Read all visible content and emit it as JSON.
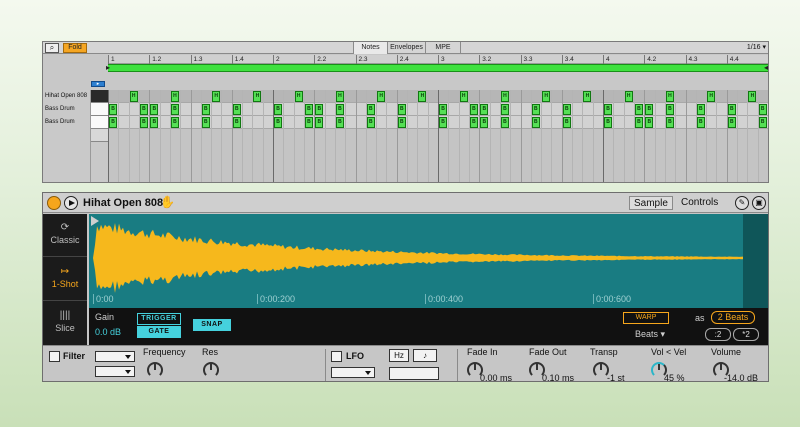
{
  "clip": {
    "fold_label": "Fold",
    "tabs": [
      "Notes",
      "Envelopes",
      "MPE"
    ],
    "grid": "1/16 ▾",
    "ruler": [
      "1",
      "1.2",
      "1.3",
      "1.4",
      "2",
      "2.2",
      "2.3",
      "2.4",
      "3",
      "3.2",
      "3.3",
      "3.4",
      "4",
      "4.2",
      "4.3",
      "4.4"
    ],
    "tracks": [
      "Hihat Open 808",
      "Bass Drum",
      "Bass Drum"
    ],
    "note_glyphs": {
      "hihat": "H",
      "bass": "B"
    }
  },
  "device": {
    "title": "Hihat Open 808",
    "tabs": [
      "Sample",
      "Controls"
    ],
    "modes": [
      {
        "icon": "⟳",
        "label": "Classic"
      },
      {
        "icon": "↦",
        "label": "1-Shot"
      },
      {
        "icon": "||||",
        "label": "Slice"
      }
    ],
    "time_labels": [
      "0:00",
      "0:00:200",
      "0:00:400",
      "0:00:600"
    ],
    "gain_label": "Gain",
    "gain_value": "0.0 dB",
    "trigger_label": "TRIGGER",
    "gate_label": "GATE",
    "snap_label": "SNAP",
    "warp_label": "WARP",
    "as_label": "as",
    "beats_value": "2 Beats",
    "beats_mode": "Beats",
    "div_label": ":2",
    "mul_label": "*2",
    "filter_label": "Filter",
    "frequency_label": "Frequency",
    "res_label": "Res",
    "lfo_label": "LFO",
    "hz_label": "Hz",
    "note_icon": "♪",
    "fade_in_label": "Fade In",
    "fade_in_value": "0.00 ms",
    "fade_out_label": "Fade Out",
    "fade_out_value": "0.10 ms",
    "transp_label": "Transp",
    "transp_value": "-1 st",
    "vel_label": "Vol < Vel",
    "vel_value": "45 %",
    "volume_label": "Volume",
    "volume_value": "-14.0 dB"
  },
  "colors": {
    "accent": "#f6a61c",
    "note_green": "#55e055",
    "wave_bg": "#197c82",
    "wave_fill": "#f6b81c",
    "cyan": "#45d1dd"
  }
}
